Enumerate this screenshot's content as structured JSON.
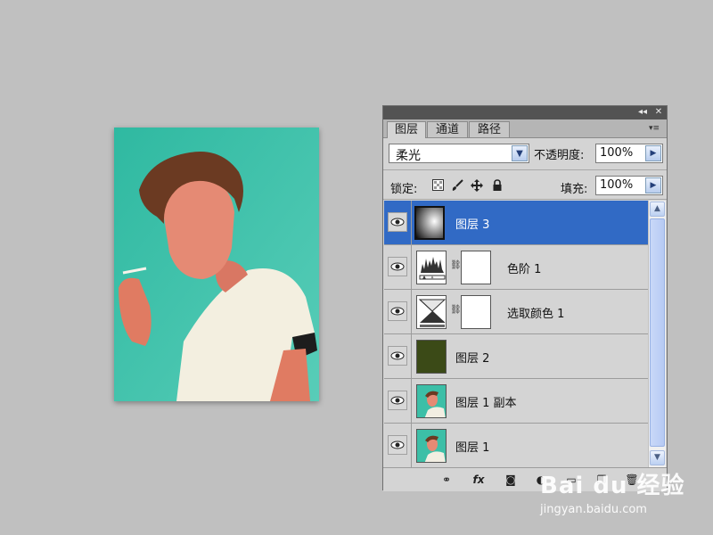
{
  "panel": {
    "tabs": [
      {
        "label": "图层",
        "active": true
      },
      {
        "label": "通道",
        "active": false
      },
      {
        "label": "路径",
        "active": false
      }
    ],
    "titlebar_collapse": "◂◂",
    "titlebar_close": "✕",
    "menu_icon": "▾≡",
    "blend_mode": "柔光",
    "opacity_label": "不透明度:",
    "opacity_value": "100%",
    "lock_label": "锁定:",
    "fill_label": "填充:",
    "fill_value": "100%",
    "layers": [
      {
        "name": "图层 3",
        "selected": true,
        "thumb": "gradient-black-white",
        "mask": false
      },
      {
        "name": "色阶 1",
        "selected": false,
        "thumb": "levels-adjustment-icon",
        "mask": true
      },
      {
        "name": "选取颜色 1",
        "selected": false,
        "thumb": "selective-color-adjustment-icon",
        "mask": true
      },
      {
        "name": "图层 2",
        "selected": false,
        "thumb": "solid-dark-olive",
        "mask": false
      },
      {
        "name": "图层 1 副本",
        "selected": false,
        "thumb": "photo",
        "mask": false
      },
      {
        "name": "图层 1",
        "selected": false,
        "thumb": "photo",
        "mask": false
      }
    ],
    "layer2_color": "#3b4a17",
    "selected_color": "#316ac5"
  },
  "watermark": {
    "brand": "Bai du 经验",
    "url": "jingyan.baidu.com"
  },
  "colors": {
    "canvas_bg": "#c0c0c0",
    "photo_bg": "#3cc0a8"
  }
}
